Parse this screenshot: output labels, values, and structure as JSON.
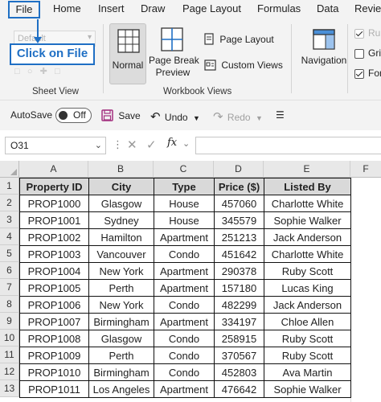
{
  "menu": {
    "tabs": [
      "File",
      "Home",
      "Insert",
      "Draw",
      "Page Layout",
      "Formulas",
      "Data",
      "Revie"
    ]
  },
  "ribbon": {
    "sheet_view": {
      "dropdown_value": "Default",
      "group_label": "Sheet View"
    },
    "callout_text": "Click on File",
    "workbook_views": {
      "normal_label": "Normal",
      "page_break_label": "Page Break",
      "page_break_label2": "Preview",
      "page_layout_label": "Page Layout",
      "custom_views_label": "Custom Views",
      "group_label": "Workbook Views"
    },
    "show": {
      "navigation_label": "Navigation",
      "ruler_label": "Rul",
      "gridlines_label": "Gri",
      "formula_label": "For"
    }
  },
  "qat": {
    "autosave_label": "AutoSave",
    "autosave_state": "Off",
    "save_label": "Save",
    "undo_label": "Undo",
    "redo_label": "Redo"
  },
  "formula_bar": {
    "name_box": "O31",
    "fx_label": "fx",
    "formula": ""
  },
  "grid": {
    "columns": [
      "A",
      "B",
      "C",
      "D",
      "E",
      "F"
    ],
    "rows": [
      "1",
      "2",
      "3",
      "4",
      "5",
      "6",
      "7",
      "8",
      "9",
      "10",
      "11",
      "12",
      "13"
    ]
  },
  "table": {
    "headers": [
      "Property ID",
      "City",
      "Type",
      "Price ($)",
      "Listed By"
    ],
    "rows": [
      [
        "PROP1000",
        "Glasgow",
        "House",
        "457060",
        "Charlotte White"
      ],
      [
        "PROP1001",
        "Sydney",
        "House",
        "345579",
        "Sophie Walker"
      ],
      [
        "PROP1002",
        "Hamilton",
        "Apartment",
        "251213",
        "Jack Anderson"
      ],
      [
        "PROP1003",
        "Vancouver",
        "Condo",
        "451642",
        "Charlotte White"
      ],
      [
        "PROP1004",
        "New York",
        "Apartment",
        "290378",
        "Ruby Scott"
      ],
      [
        "PROP1005",
        "Perth",
        "Apartment",
        "157180",
        "Lucas King"
      ],
      [
        "PROP1006",
        "New York",
        "Condo",
        "482299",
        "Jack Anderson"
      ],
      [
        "PROP1007",
        "Birmingham",
        "Apartment",
        "334197",
        "Chloe Allen"
      ],
      [
        "PROP1008",
        "Glasgow",
        "Condo",
        "258915",
        "Ruby Scott"
      ],
      [
        "PROP1009",
        "Perth",
        "Condo",
        "370567",
        "Ruby Scott"
      ],
      [
        "PROP1010",
        "Birmingham",
        "Condo",
        "452803",
        "Ava Martin"
      ],
      [
        "PROP1011",
        "Los Angeles",
        "Apartment",
        "476642",
        "Sophie Walker"
      ]
    ]
  },
  "colors": {
    "accent": "#1f6fc4",
    "header_fill": "#d9d9d9",
    "save_icon": "#a3307f"
  },
  "icons": [
    "save-icon",
    "undo-icon",
    "redo-icon",
    "cancel-icon",
    "enter-icon",
    "function-icon",
    "normal-view-icon",
    "page-break-icon",
    "page-layout-icon",
    "custom-views-icon",
    "navigation-icon"
  ]
}
